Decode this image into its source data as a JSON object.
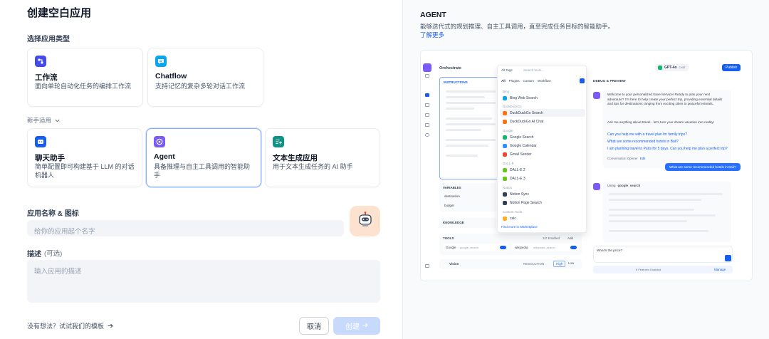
{
  "left": {
    "title": "创建空白应用",
    "section_type": "选择应用类型",
    "cards_top": [
      {
        "title": "工作流",
        "desc": "面向单轮自动化任务的编排工作流",
        "icon": "workflow-icon",
        "color": "#444ce7"
      },
      {
        "title": "Chatflow",
        "desc": "支持记忆的复杂多轮对话工作流",
        "icon": "chatflow-icon",
        "color": "#0ba5ec"
      }
    ],
    "beginner_label": "新手适用",
    "cards_bottom": [
      {
        "title": "聊天助手",
        "desc": "简单配置即可构建基于 LLM 的对话机器人",
        "icon": "chat-bot-icon",
        "color": "#155eef"
      },
      {
        "title": "Agent",
        "desc": "具备推理与自主工具调用的智能助手",
        "icon": "agent-icon",
        "color": "#7a5af8"
      },
      {
        "title": "文本生成应用",
        "desc": "用于文本生成任务的 AI 助手",
        "icon": "text-gen-icon",
        "color": "#0e9384"
      }
    ],
    "name_label": "应用名称 & 图标",
    "name_placeholder": "给你的应用起个名字",
    "desc_label": "描述",
    "desc_optional": "(可选)",
    "desc_placeholder": "输入应用的描述",
    "template_link": "没有想法？试试我们的模板",
    "cancel": "取消",
    "create": "创建"
  },
  "right": {
    "heading": "AGENT",
    "subtitle": "能够迭代式的规划推理、自主工具调用，直至完成任务目标的智能助手。",
    "learn_more": "了解更多",
    "preview": {
      "orchestrate": "Orchestrate",
      "instructions": "INSTRUCTIONS",
      "variables": "VARIABLES",
      "var1": "destination",
      "var2": "budget",
      "knowledge": "KNOWLEDGE",
      "tools": "TOOLS",
      "tools_enabled": "2/2 Enabled",
      "add": "Add",
      "tool1": "Google",
      "tool1_sub": "google_search",
      "tool2": "wikipedia",
      "tool2_sub": "wikipedia_search",
      "vision": "Vision",
      "resolution": "RESOLUTION",
      "high": "High",
      "low": "Low",
      "all_tags": "All Tags",
      "search": "Search tools...",
      "filters": [
        "All",
        "Plugins",
        "Custom",
        "Workflow"
      ],
      "groups": [
        {
          "name": "Bing",
          "items": [
            "Bing Web Search"
          ]
        },
        {
          "name": "DuckDuckGo",
          "items": [
            "DuckDuckGo Search",
            "DuckDuckGo AI Chat"
          ]
        },
        {
          "name": "Google",
          "items": [
            "Google Search",
            "Google Calendar",
            "Gmail Sender"
          ]
        },
        {
          "name": "DALL-E",
          "items": [
            "DALL-E 2",
            "DALL-E 3"
          ]
        },
        {
          "name": "Notion",
          "items": [
            "Notion Sync",
            "Notion Page Search"
          ]
        },
        {
          "name": "Custom Tools",
          "items": [
            "calc"
          ]
        }
      ],
      "marketplace": "Find more in Marketplace",
      "model": "GPT-4o",
      "model_tag": "CHAT",
      "publish": "Publish",
      "debug": "DEBUG & PREVIEW",
      "welcome": "Welcome to your personalized travel service! Ready to plan your next adventure? I'm here to help create your perfect trip, providing essential details and tips for destinations ranging from exciting cities to peaceful retreats.",
      "ask": "Ask me anything about travel - let's turn your dream vacation into reality!",
      "suggestions": [
        "Can you help me with a travel plan for family trips?",
        "What are some recommended hotels in Bali?",
        "I am planning travel to Paris for 5 days. Can you help me plan a perfect trip?"
      ],
      "opener": "Conversation Opener",
      "edit": "Edit",
      "user_msg": "What are some recommended hotels in Bali?",
      "using": "Using",
      "using_tool": "google_search",
      "chat_input": "What's the price?",
      "features": "6 Features Enabled",
      "manage": "Manage"
    }
  }
}
